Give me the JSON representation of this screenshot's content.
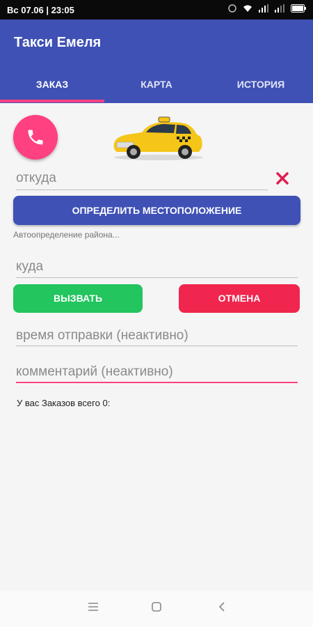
{
  "status_bar": {
    "time": "Вс 07.06 | 23:05"
  },
  "app": {
    "title": "Такси Емеля"
  },
  "tabs": [
    {
      "label": "ЗАКАЗ"
    },
    {
      "label": "КАРТА"
    },
    {
      "label": "ИСТОРИЯ"
    }
  ],
  "colors": {
    "primary": "#3f51b5",
    "accent": "#ff4081",
    "call": "#22c55e",
    "cancel": "#f0264e"
  },
  "form": {
    "from_placeholder": "откуда",
    "locate_button": "ОПРЕДЕЛИТЬ МЕСТОПОЛОЖЕНИЕ",
    "auto_detect_text": "Автоопределение района...",
    "to_placeholder": "куда",
    "call_button": "ВЫЗВАТЬ",
    "cancel_button": "ОТМЕНА",
    "time_placeholder": "время отправки (неактивно)",
    "comment_placeholder": "комментарий (неактивно)"
  },
  "orders_text": "У вас Заказов всего 0:",
  "icons": [
    "phone-icon",
    "taxi-car-image",
    "clear-icon",
    "menu-icon",
    "home-icon",
    "back-icon"
  ]
}
